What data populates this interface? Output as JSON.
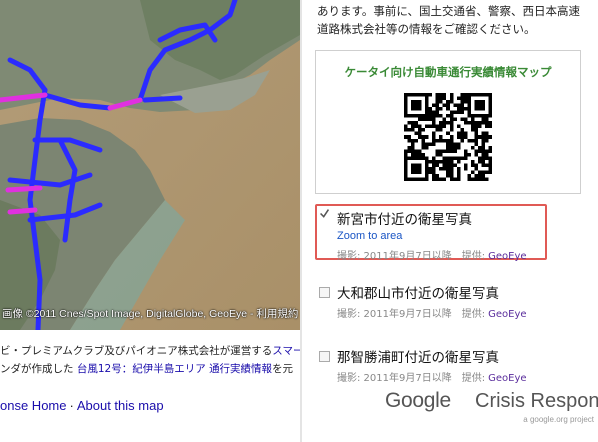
{
  "map": {
    "attribution": "画像 ©2011 Cnes/Spot Image, DigitalGlobe, GeoEye - 利用規約",
    "colors": {
      "route_blue": "#2b2bff",
      "route_magenta": "#e030e0",
      "sea": "#b8a17a",
      "land": "#8a8f7c"
    }
  },
  "credits": {
    "line1_prefix": "ビ・プレミアムクラブ及びパイオニア株式会社が運営する",
    "line1_link": "スマー",
    "line2_prefix": "ンダが作成した",
    "line2_link1": "台風12号：紀伊半島エリア",
    "line2_link2": "通行実績情報",
    "line2_suffix": "を元"
  },
  "footer": {
    "link1": "onse Home",
    "separator": "·",
    "link2": "About this map"
  },
  "sidebar": {
    "intro_line1": "あります。事前に、国土交通省、警察、西日本高速",
    "intro_line2": "道路株式会社等の情報をご確認ください。",
    "mobile_map_title": "ケータイ向け自動車通行実績情報マップ",
    "layers": [
      {
        "name": "新宮市付近の衛星写真",
        "checked": true,
        "zoom": "Zoom to area",
        "date": "撮影: 2011年9月7日以降",
        "provider_label": "提供:",
        "provider": "GeoEye"
      },
      {
        "name": "大和郡山市付近の衛星写真",
        "checked": false,
        "date": "撮影: 2011年9月7日以降",
        "provider_label": "提供:",
        "provider": "GeoEye"
      },
      {
        "name": "那智勝浦町付近の衛星写真",
        "checked": false,
        "date": "撮影: 2011年9月7日以降",
        "provider_label": "提供:",
        "provider": "GeoEye"
      }
    ],
    "highlight_color": "#e05a55"
  },
  "branding": {
    "google": "Google",
    "crisis_response": "Crisis Response",
    "sub": "a google.org project"
  }
}
